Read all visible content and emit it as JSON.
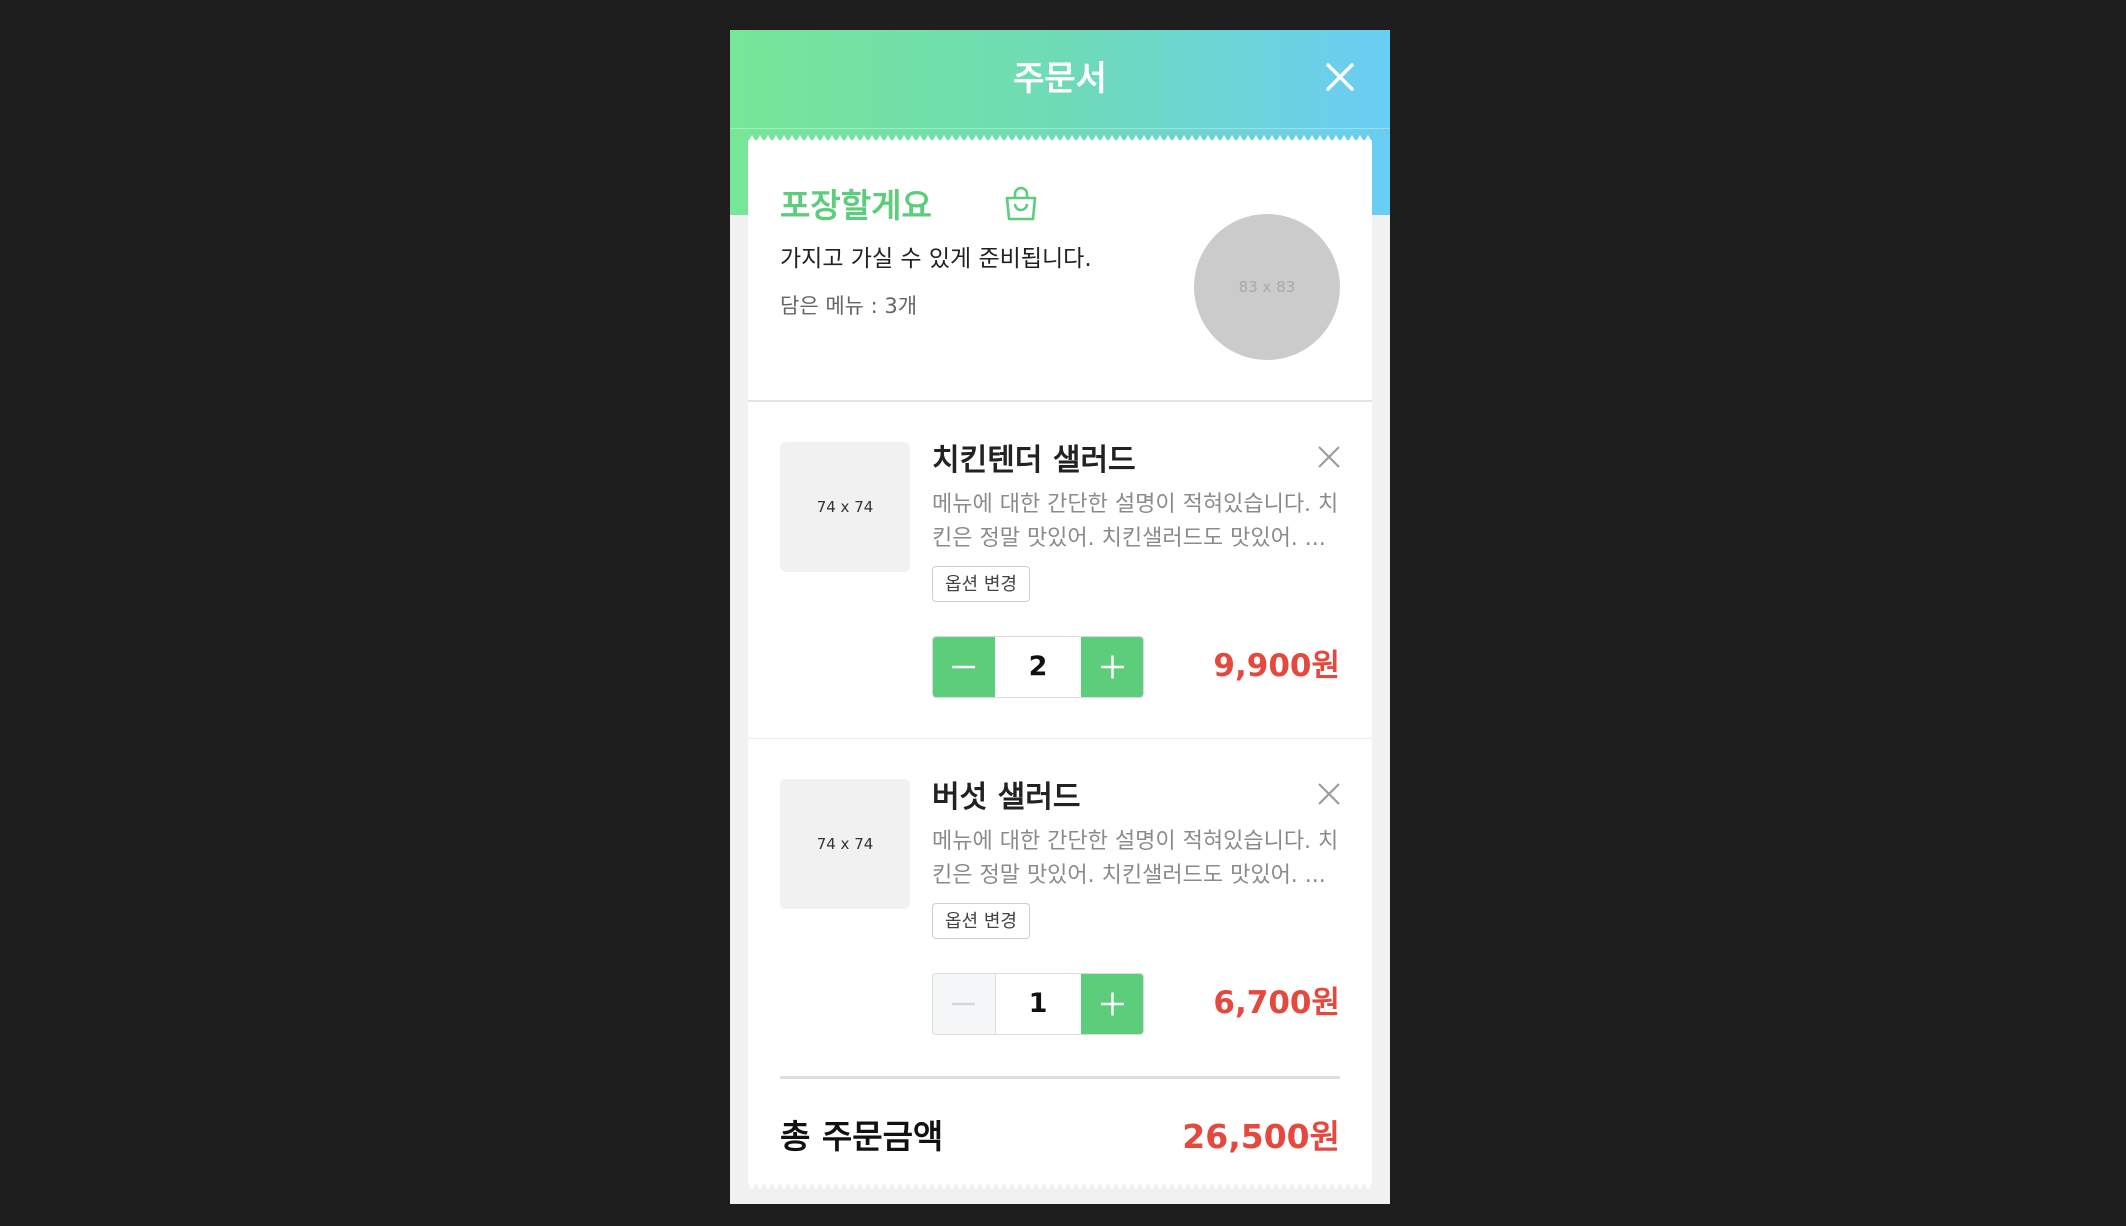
{
  "header": {
    "title": "주문서",
    "close_icon": "close-icon"
  },
  "takeout": {
    "title": "포장할게요",
    "icon": "shopping-bag-icon",
    "description": "가지고 가실 수 있게 준비됩니다.",
    "menu_count": "담은 메뉴 : 3개",
    "image_placeholder": "83 x 83"
  },
  "items": [
    {
      "thumb": "74 x 74",
      "name": "치킨텐더 샐러드",
      "description": "메뉴에 대한 간단한 설명이 적혀있습니다. 치\n킨은 정말 맛있어. 치킨샐러드도 맛있어. ...",
      "option_label": "옵션 변경",
      "quantity": "2",
      "price": "9,900원",
      "minus_enabled": true
    },
    {
      "thumb": "74 x 74",
      "name": "버섯 샐러드",
      "description": "메뉴에 대한 간단한 설명이 적혀있습니다. 치\n킨은 정말 맛있어. 치킨샐러드도 맛있어. ...",
      "option_label": "옵션 변경",
      "quantity": "1",
      "price": "6,700원",
      "minus_enabled": false
    }
  ],
  "total": {
    "label": "총 주문금액",
    "amount": "26,500원"
  },
  "colors": {
    "accent_green": "#5ccd7b",
    "price_red": "#e5483d",
    "gradient_start": "#77e697",
    "gradient_end": "#6acdf5"
  }
}
